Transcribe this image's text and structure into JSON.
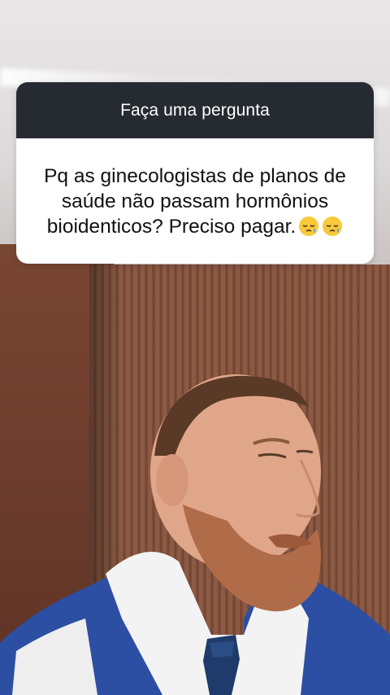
{
  "question_card": {
    "header": "Faça uma pergunta",
    "question": "Pq as ginecologistas de planos de saúde não passam hormônios bioidenticos? Preciso pagar.",
    "emojis": [
      "sleepy-face-emoji",
      "sleepy-face-emoji"
    ]
  },
  "colors": {
    "card_header_bg": "#262a31",
    "card_header_text": "#ffffff",
    "card_body_bg": "#ffffff",
    "question_text": "#111111"
  }
}
